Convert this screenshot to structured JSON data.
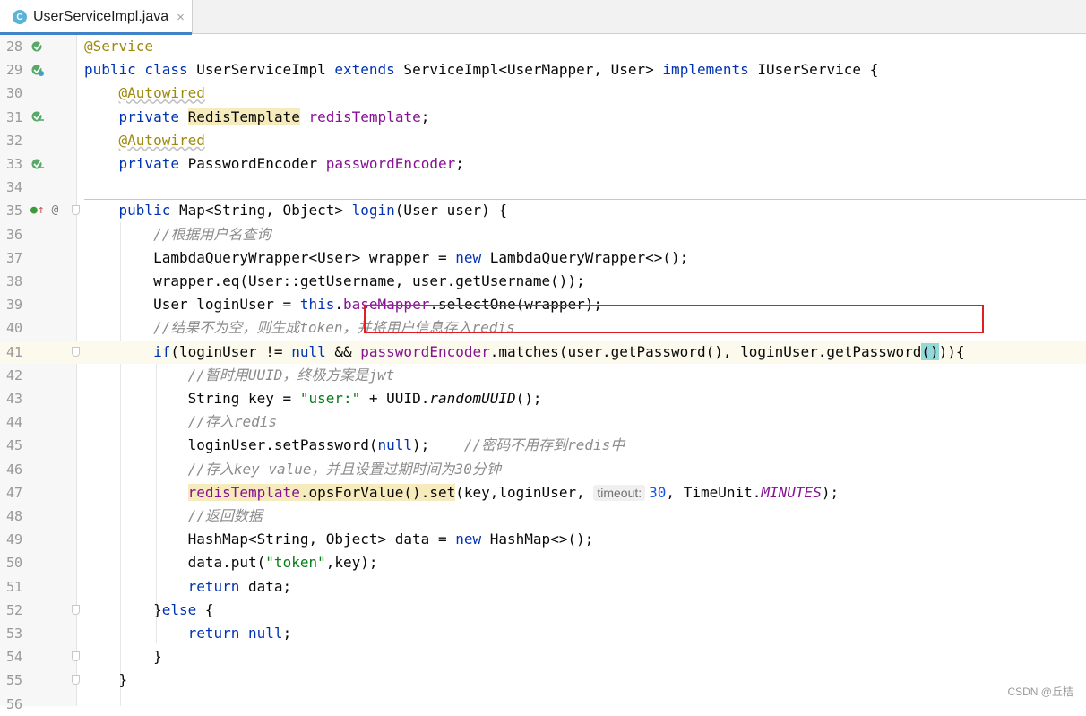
{
  "tab": {
    "title": "UserServiceImpl.java",
    "icon": "class-icon",
    "icon_letter": "C",
    "close_glyph": "×"
  },
  "gutter_icons": {
    "28": "bean-icon",
    "29": "bean-class-icon",
    "31": "autowired-bean-icon",
    "33": "autowired-bean-icon",
    "35": "implements-method-icon"
  },
  "lines": [
    {
      "n": "28",
      "html": "<span class=\"ann\">@Service</span>"
    },
    {
      "n": "29",
      "html": "<span class=\"kw\">public class</span> UserServiceImpl <span class=\"kw\">extends</span> ServiceImpl&lt;UserMapper, User&gt; <span class=\"kw\">implements</span> IUserService {"
    },
    {
      "n": "30",
      "html": "    <span class=\"ann-u\">@Autowired</span>"
    },
    {
      "n": "31",
      "html": "    <span class=\"kw\">private</span> <span class=\"hl\">RedisTemplate</span> <span class=\"fld\">redisTemplate</span>;"
    },
    {
      "n": "32",
      "html": "    <span class=\"ann-u\">@Autowired</span>"
    },
    {
      "n": "33",
      "html": "    <span class=\"kw\">private</span> PasswordEncoder <span class=\"fld\">passwordEncoder</span>;"
    },
    {
      "n": "34",
      "html": ""
    },
    {
      "n": "35",
      "html": "    <span class=\"kw\">public</span> Map&lt;String, Object&gt; <span class=\"kw\">login</span>(User user) {"
    },
    {
      "n": "36",
      "html": "        <span class=\"cmt\">//根据用户名查询</span>"
    },
    {
      "n": "37",
      "html": "        LambdaQueryWrapper&lt;User&gt; wrapper = <span class=\"kw\">new</span> LambdaQueryWrapper&lt;&gt;();"
    },
    {
      "n": "38",
      "html": "        wrapper.eq(User::getUsername, user.getUsername());"
    },
    {
      "n": "39",
      "html": "        User loginUser = <span class=\"kw\">this</span>.<span class=\"fld\">baseMapper</span>.selectOne(wrapper);"
    },
    {
      "n": "40",
      "html": "        <span class=\"cmt\">//结果不为空，则生成token，并将用户信息存入redis</span>"
    },
    {
      "n": "41",
      "html": "        <span class=\"kw\">if</span>(loginUser != <span class=\"kw\">null</span> &amp;&amp; <span class=\"fld\">passwordEncoder</span>.matches(user.getPassword(), loginUser.getPassword<span class=\"brace-hl\">()</span>)){"
    },
    {
      "n": "42",
      "html": "            <span class=\"cmt\">//暂时用UUID，终极方案是jwt</span>"
    },
    {
      "n": "43",
      "html": "            String key = <span class=\"str\">\"user:\"</span> + UUID.<span class=\"ital\">randomUUID</span>();"
    },
    {
      "n": "44",
      "html": "            <span class=\"cmt\">//存入redis</span>"
    },
    {
      "n": "45",
      "html": "            loginUser.setPassword(<span class=\"kw\">null</span>);    <span class=\"cmt\">//密码不用存到redis中</span>"
    },
    {
      "n": "46",
      "html": "            <span class=\"cmt\">//存入key value，并且设置过期时间为30分钟</span>"
    },
    {
      "n": "47",
      "html": "            <span class=\"hl\"><span class=\"fld\">redisTemplate</span>.opsForValue().set</span>(key,loginUser, <span class=\"hint\">timeout:</span><span class=\"num\">30</span>, TimeUnit.<span class=\"ital-fld\">MINUTES</span>);"
    },
    {
      "n": "48",
      "html": "            <span class=\"cmt\">//返回数据</span>"
    },
    {
      "n": "49",
      "html": "            HashMap&lt;String, Object&gt; data = <span class=\"kw\">new</span> HashMap&lt;&gt;();"
    },
    {
      "n": "50",
      "html": "            data.put(<span class=\"str\">\"token\"</span>,key);"
    },
    {
      "n": "51",
      "html": "            <span class=\"kw\">return</span> data;"
    },
    {
      "n": "52",
      "html": "        }<span class=\"kw\">else</span> {"
    },
    {
      "n": "53",
      "html": "            <span class=\"kw\">return null</span>;"
    },
    {
      "n": "54",
      "html": "        }"
    },
    {
      "n": "55",
      "html": "    }"
    },
    {
      "n": "56",
      "html": ""
    }
  ],
  "current_line": "41",
  "watermark": "CSDN @丘桔"
}
